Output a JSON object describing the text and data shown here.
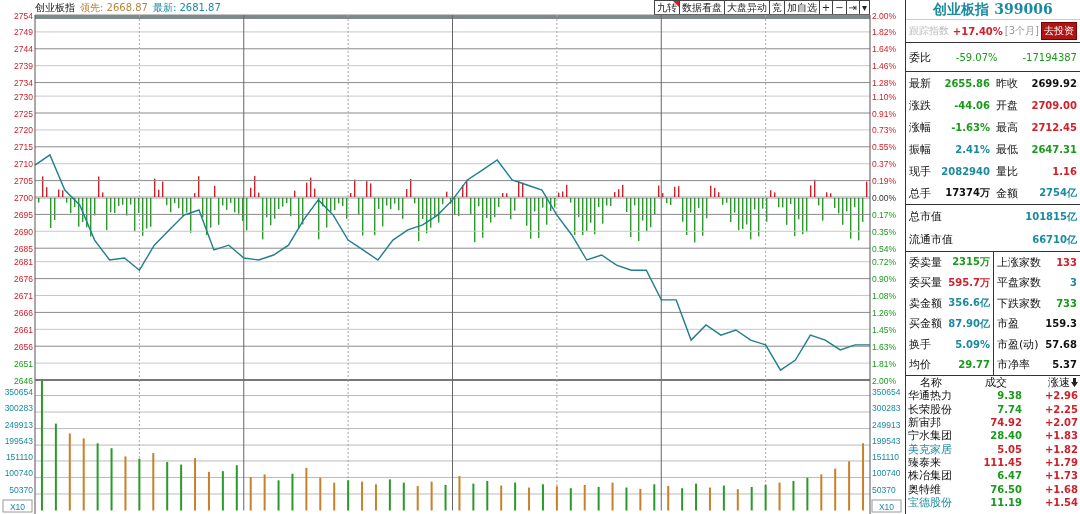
{
  "chart_header": {
    "title": "创业板指",
    "leader": "领先: 2668.87",
    "latest": "最新: 2681.87"
  },
  "toolbar": [
    {
      "label": "九转",
      "flagged": true
    },
    {
      "label": "数据看盘",
      "flagged": false
    },
    {
      "label": "大盘异动",
      "flagged": false
    },
    {
      "label": "竞",
      "flagged": false
    },
    {
      "label": "加自选",
      "flagged": false
    },
    {
      "label": "+",
      "flagged": false
    },
    {
      "label": "−",
      "flagged": false
    },
    {
      "label": "⇥",
      "flagged": false
    },
    {
      "label": "▾",
      "flagged": false
    }
  ],
  "price_chart": {
    "right_axis_labels": [
      "2.00%",
      "1.82%",
      "1.64%",
      "1.46%",
      "1.28%",
      "1.10%",
      "0.91%",
      "0.73%",
      "0.55%",
      "0.37%",
      "0.19%",
      "0.00%",
      "0.17%",
      "0.35%",
      "0.54%",
      "0.72%",
      "0.90%",
      "1.08%",
      "1.26%",
      "1.45%",
      "1.63%",
      "1.81%",
      "2.00%"
    ],
    "chart_data": {
      "type": "line",
      "grid": true,
      "ylim": [
        2646,
        2754
      ],
      "yticks": [
        2754,
        2749,
        2744,
        2739,
        2734,
        2730,
        2725,
        2720,
        2715,
        2710,
        2705,
        2700,
        2695,
        2690,
        2685,
        2681,
        2676,
        2671,
        2666,
        2661,
        2656,
        2651,
        2646
      ],
      "series": [
        {
          "color": "#1f7f8f",
          "values": [
            2709.6,
            2712.6,
            2702.2,
            2697.8,
            2687.4,
            2681.5,
            2682.1,
            2678.5,
            2685.9,
            2690.4,
            2694.8,
            2696.3,
            2684.5,
            2685.9,
            2682.1,
            2681.5,
            2683.0,
            2685.9,
            2693.3,
            2699.3,
            2694.8,
            2687.4,
            2684.5,
            2681.5,
            2687.4,
            2690.4,
            2691.9,
            2694.8,
            2699.3,
            2705.2,
            2708.1,
            2711.1,
            2705.2,
            2703.7,
            2702.2,
            2694.8,
            2688.9,
            2681.5,
            2683.0,
            2680.0,
            2678.5,
            2678.5,
            2669.7,
            2669.7,
            2657.8,
            2662.3,
            2659.3,
            2660.8,
            2657.8,
            2656.4,
            2648.9,
            2651.9,
            2659.3,
            2657.8,
            2654.9,
            2656.4,
            2656.4
          ]
        }
      ]
    }
  },
  "volume_chart": {
    "scale_labels": [
      "X10",
      "X10"
    ],
    "right_axis_labels": [
      "350654",
      "300283",
      "249913",
      "199543",
      "151110",
      "100740",
      "50370"
    ],
    "chart_data": {
      "type": "bar",
      "grid": true,
      "ylim": [
        0,
        398000
      ],
      "yticks": [
        350654,
        300283,
        249913,
        199543,
        151110,
        100740,
        50370
      ],
      "series": [
        {
          "color": "#c8802a",
          "values": [
            null,
            null,
            235000,
            220000,
            null,
            null,
            165000,
            null,
            175000,
            null,
            null,
            160000,
            118000,
            null,
            null,
            102000,
            110000,
            null,
            null,
            130000,
            100000,
            85000,
            null,
            88000,
            80000,
            null,
            null,
            75000,
            88000,
            null,
            105000,
            null,
            null,
            76000,
            null,
            70000,
            null,
            74000,
            null,
            78000,
            null,
            85000,
            null,
            66000,
            null,
            75000,
            null,
            null,
            70000,
            null,
            65000,
            null,
            null,
            85000,
            null,
            null,
            110000,
            128000,
            150000,
            205000
          ]
        },
        {
          "color": "#2a9a2a",
          "values": [
            395000,
            265000,
            null,
            null,
            205000,
            190000,
            null,
            158000,
            null,
            148000,
            140000,
            null,
            null,
            120000,
            138000,
            null,
            null,
            92000,
            112000,
            null,
            null,
            null,
            92000,
            null,
            null,
            95000,
            85000,
            null,
            null,
            78000,
            null,
            82000,
            90000,
            null,
            85000,
            null,
            80000,
            null,
            68000,
            null,
            72000,
            null,
            70000,
            null,
            80000,
            null,
            68000,
            82000,
            null,
            76000,
            null,
            72000,
            78000,
            null,
            90000,
            100000,
            null,
            null,
            null,
            null
          ]
        }
      ]
    }
  },
  "quote_panel": {
    "title": "创业板指 399006",
    "tracking": {
      "label": "跟踪指数",
      "change": "+17.40%",
      "period": "[3个月]",
      "button": "去投资"
    },
    "order_ratio": {
      "label": "委比",
      "percent": "-59.07%",
      "value": "-17194387"
    },
    "stats": [
      {
        "label": "最新",
        "value": "2655.86",
        "color": "#1a9a1a"
      },
      {
        "label": "昨收",
        "value": "2699.92",
        "color": "#111111"
      },
      {
        "label": "涨跌",
        "value": "-44.06",
        "color": "#1a9a1a"
      },
      {
        "label": "开盘",
        "value": "2709.00",
        "color": "#d0202a"
      },
      {
        "label": "涨幅",
        "value": "-1.63%",
        "color": "#1a9a1a"
      },
      {
        "label": "最高",
        "value": "2712.45",
        "color": "#d0202a"
      },
      {
        "label": "振幅",
        "value": "2.41%",
        "color": "#1a8aa0"
      },
      {
        "label": "最低",
        "value": "2647.31",
        "color": "#1a9a1a"
      },
      {
        "label": "现手",
        "value": "2082940",
        "color": "#1a8aa0"
      },
      {
        "label": "量比",
        "value": "1.16",
        "color": "#d0202a"
      },
      {
        "label": "总手",
        "value": "17374万",
        "color": "#111111"
      },
      {
        "label": "金额",
        "value": "2754亿",
        "color": "#1a8aa0"
      }
    ],
    "market_value": [
      {
        "label": "总市值",
        "value": "101815亿"
      },
      {
        "label": "流通市值",
        "value": "66710亿"
      }
    ],
    "breadth": [
      {
        "label": "委卖量",
        "value": "2315万",
        "color": "#1a9a1a"
      },
      {
        "label": "上涨家数",
        "value": "133",
        "color": "#d0202a"
      },
      {
        "label": "委买量",
        "value": "595.7万",
        "color": "#d0202a"
      },
      {
        "label": "平盘家数",
        "value": "3",
        "color": "#1a8aa0"
      },
      {
        "label": "卖金额",
        "value": "356.6亿",
        "color": "#1a8aa0"
      },
      {
        "label": "下跌家数",
        "value": "733",
        "color": "#1a9a1a"
      },
      {
        "label": "买金额",
        "value": "87.90亿",
        "color": "#1a8aa0"
      },
      {
        "label": "市盈",
        "value": "159.3",
        "color": "#111111"
      },
      {
        "label": "换手",
        "value": "5.09%",
        "color": "#1a8aa0"
      },
      {
        "label": "市盈(动)",
        "value": "57.68",
        "color": "#111111"
      },
      {
        "label": "均价",
        "value": "29.77",
        "color": "#1a9a1a"
      },
      {
        "label": "市净率",
        "value": "5.37",
        "color": "#111111"
      }
    ]
  },
  "movers": {
    "columns": [
      "名称",
      "成交",
      "涨速"
    ],
    "rows": [
      {
        "name": "华通热力",
        "highlighted": false,
        "price": "9.38",
        "color": "#1a9a1a",
        "speed": "+2.96"
      },
      {
        "name": "长荣股份",
        "highlighted": false,
        "price": "7.74",
        "color": "#1a9a1a",
        "speed": "+2.25"
      },
      {
        "name": "新宙邦",
        "highlighted": false,
        "price": "74.92",
        "color": "#d0202a",
        "speed": "+2.07"
      },
      {
        "name": "宁水集团",
        "highlighted": false,
        "price": "28.40",
        "color": "#1a9a1a",
        "speed": "+1.83"
      },
      {
        "name": "美克家居",
        "highlighted": true,
        "price": "5.05",
        "color": "#d0202a",
        "speed": "+1.82"
      },
      {
        "name": "臻泰来",
        "highlighted": false,
        "price": "111.45",
        "color": "#d0202a",
        "speed": "+1.79"
      },
      {
        "name": "株冶集团",
        "highlighted": false,
        "price": "6.47",
        "color": "#1a9a1a",
        "speed": "+1.73"
      },
      {
        "name": "奥特维",
        "highlighted": false,
        "price": "76.50",
        "color": "#1a9a1a",
        "speed": "+1.68"
      },
      {
        "name": "宝德股份",
        "highlighted": true,
        "price": "11.19",
        "color": "#1a9a1a",
        "speed": "+1.54"
      }
    ]
  }
}
